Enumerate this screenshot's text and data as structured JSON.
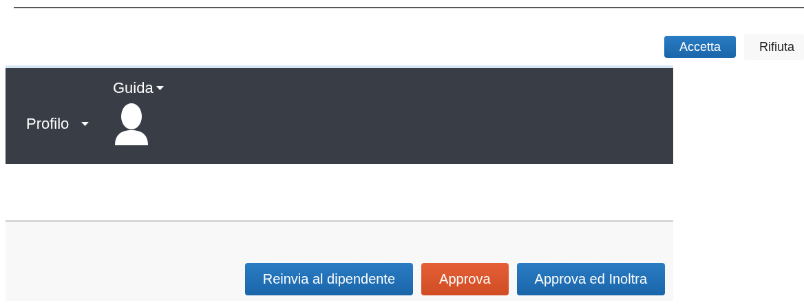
{
  "consent_buttons": [
    {
      "label": "Accetta",
      "kind": "primary"
    },
    {
      "label": "Rifiuta",
      "kind": "plain"
    }
  ],
  "navbar": {
    "help_menu": {
      "label": "Guida"
    },
    "profile_menu": {
      "label": "Profilo"
    }
  },
  "actions": [
    {
      "label": "Reinvia al dipendente",
      "kind": "primary"
    },
    {
      "label": "Approva",
      "kind": "danger"
    },
    {
      "label": "Approva ed Inoltra",
      "kind": "primary"
    }
  ]
}
